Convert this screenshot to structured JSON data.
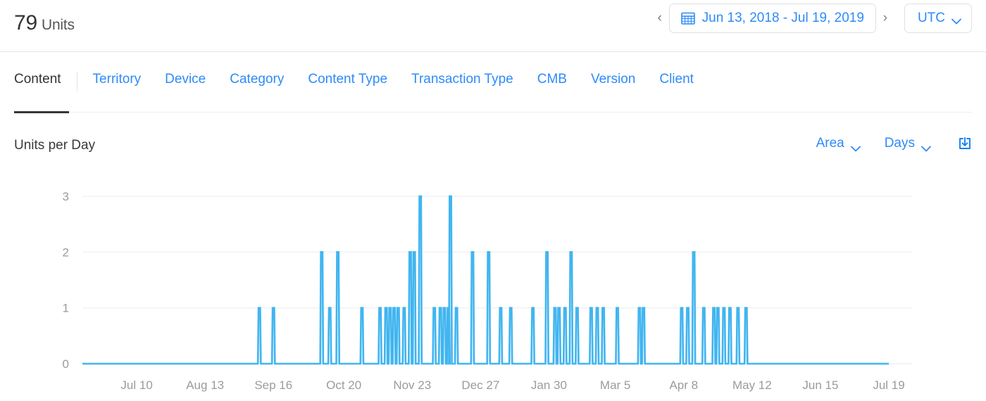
{
  "header": {
    "metric_value": "79",
    "metric_unit": "Units",
    "prev_label": "‹",
    "next_label": "›",
    "calendar_icon": "calendar-icon",
    "date_range": "Jun 13, 2018 - Jul 19, 2019",
    "timezone": "UTC",
    "timezone_caret": "chevron-down-icon"
  },
  "tabs": {
    "active": "Content",
    "items": [
      {
        "label": "Content",
        "active": true
      },
      {
        "label": "Territory",
        "active": false
      },
      {
        "label": "Device",
        "active": false
      },
      {
        "label": "Category",
        "active": false
      },
      {
        "label": "Content Type",
        "active": false
      },
      {
        "label": "Transaction Type",
        "active": false
      },
      {
        "label": "CMB",
        "active": false
      },
      {
        "label": "Version",
        "active": false
      },
      {
        "label": "Client",
        "active": false
      }
    ]
  },
  "chart_toolbar": {
    "title": "Units per Day",
    "chart_type": "Area",
    "chart_type_caret": "chevron-down-icon",
    "granularity": "Days",
    "granularity_caret": "chevron-down-icon",
    "export_icon": "download-icon"
  },
  "colors": {
    "accent": "#2e8bf7",
    "series_line": "#41b5f0",
    "series_fill": "#e8f5fd",
    "grid": "#f0f0f0",
    "axis_text": "#9b9b9b",
    "tab_active_underline": "#363636"
  },
  "chart_data": {
    "type": "area",
    "title": "Units per Day",
    "xlabel": "",
    "ylabel": "",
    "ylim": [
      0,
      3
    ],
    "yticks": [
      0,
      1,
      2,
      3
    ],
    "grid": true,
    "legend": "none",
    "granularity": "Days",
    "x_range": "Jun 13, 2018 - Jul 19, 2019",
    "x_tick_labels": [
      "Jul 10",
      "Aug 13",
      "Sep 16",
      "Oct 20",
      "Nov 23",
      "Dec 27",
      "Jan 30",
      "Mar 5",
      "Apr 8",
      "May 12",
      "Jun 15",
      "Jul 19"
    ],
    "x_tick_positions": [
      27,
      61,
      95,
      130,
      164,
      198,
      232,
      265,
      299,
      333,
      367,
      401
    ],
    "n_points": 402,
    "total_units": 79,
    "series": [
      {
        "name": "Units",
        "nonzero_points": [
          {
            "i": 88,
            "v": 1
          },
          {
            "i": 95,
            "v": 1
          },
          {
            "i": 119,
            "v": 2
          },
          {
            "i": 123,
            "v": 1
          },
          {
            "i": 127,
            "v": 2
          },
          {
            "i": 139,
            "v": 1
          },
          {
            "i": 148,
            "v": 1
          },
          {
            "i": 151,
            "v": 1
          },
          {
            "i": 153,
            "v": 1
          },
          {
            "i": 155,
            "v": 1
          },
          {
            "i": 157,
            "v": 1
          },
          {
            "i": 160,
            "v": 1
          },
          {
            "i": 163,
            "v": 2
          },
          {
            "i": 165,
            "v": 2
          },
          {
            "i": 168,
            "v": 3
          },
          {
            "i": 175,
            "v": 1
          },
          {
            "i": 178,
            "v": 1
          },
          {
            "i": 180,
            "v": 1
          },
          {
            "i": 182,
            "v": 1
          },
          {
            "i": 183,
            "v": 3
          },
          {
            "i": 186,
            "v": 1
          },
          {
            "i": 194,
            "v": 2
          },
          {
            "i": 202,
            "v": 2
          },
          {
            "i": 208,
            "v": 1
          },
          {
            "i": 213,
            "v": 1
          },
          {
            "i": 224,
            "v": 1
          },
          {
            "i": 231,
            "v": 2
          },
          {
            "i": 235,
            "v": 1
          },
          {
            "i": 237,
            "v": 1
          },
          {
            "i": 240,
            "v": 1
          },
          {
            "i": 243,
            "v": 2
          },
          {
            "i": 246,
            "v": 1
          },
          {
            "i": 253,
            "v": 1
          },
          {
            "i": 256,
            "v": 1
          },
          {
            "i": 259,
            "v": 1
          },
          {
            "i": 266,
            "v": 1
          },
          {
            "i": 277,
            "v": 1
          },
          {
            "i": 279,
            "v": 1
          },
          {
            "i": 298,
            "v": 1
          },
          {
            "i": 301,
            "v": 1
          },
          {
            "i": 304,
            "v": 2
          },
          {
            "i": 309,
            "v": 1
          },
          {
            "i": 314,
            "v": 1
          },
          {
            "i": 316,
            "v": 1
          },
          {
            "i": 319,
            "v": 1
          },
          {
            "i": 322,
            "v": 1
          },
          {
            "i": 326,
            "v": 1
          },
          {
            "i": 330,
            "v": 1
          }
        ]
      }
    ]
  }
}
